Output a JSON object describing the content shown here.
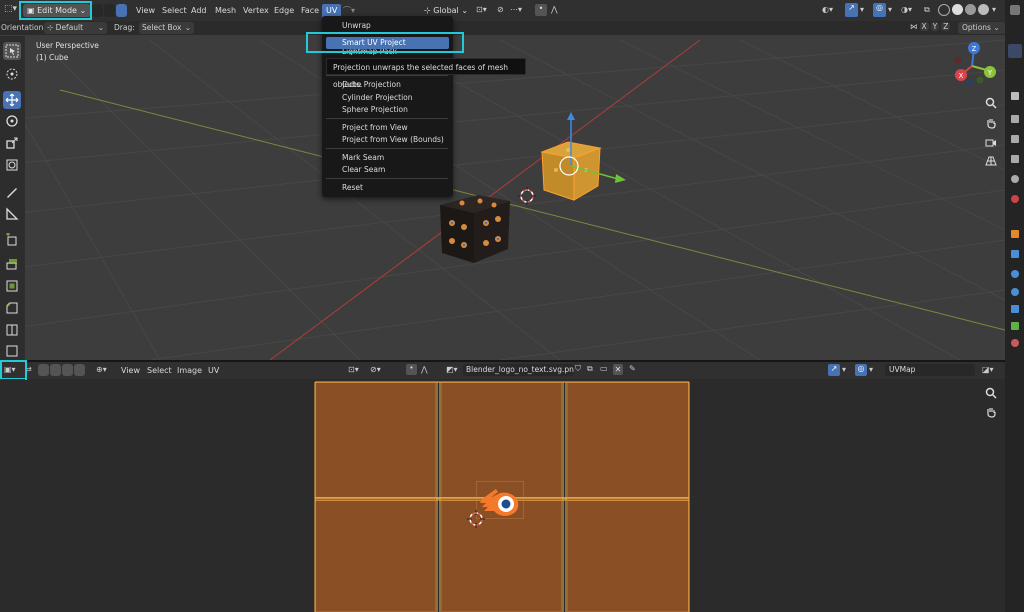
{
  "colors": {
    "accent": "#4772b3",
    "highlight": "#23c9d6",
    "uv_face": "#8a4f24",
    "header": "#303030",
    "viewport": "#3d3d3d",
    "selected_orange": "#ffa02c"
  },
  "viewport": {
    "mode_label": "Edit Mode",
    "menus": [
      "View",
      "Select",
      "Add",
      "Mesh",
      "Vertex",
      "Edge",
      "Face",
      "UV"
    ],
    "orientation_label": "Orientation:",
    "orientation_value": "Default",
    "drag_label": "Drag:",
    "drag_value": "Select Box",
    "transform_space": "Global",
    "options_label": "Options",
    "axes_labels": [
      "X",
      "Y",
      "Z"
    ],
    "perspective": "User Perspective",
    "object": "(1) Cube",
    "gizmo": {
      "x": "X",
      "y": "Y",
      "z": "Z"
    }
  },
  "uv_menu": {
    "items": {
      "unwrap": "Unwrap",
      "smart_uv": "Smart UV Project",
      "lightmap": "Lightmap Pack",
      "cube": "Cube Projection",
      "cylinder": "Cylinder Projection",
      "sphere": "Sphere Projection",
      "from_view": "Project from View",
      "from_view_bounds": "Project from View (Bounds)",
      "mark_seam": "Mark Seam",
      "clear_seam": "Clear Seam",
      "reset": "Reset"
    },
    "tooltip": "Projection unwraps the selected faces of mesh objects."
  },
  "uv_editor": {
    "menus": [
      "View",
      "Select",
      "Image",
      "UV"
    ],
    "image_name": "Blender_logo_no_text.svg.png",
    "uvmap": "UVMap"
  }
}
